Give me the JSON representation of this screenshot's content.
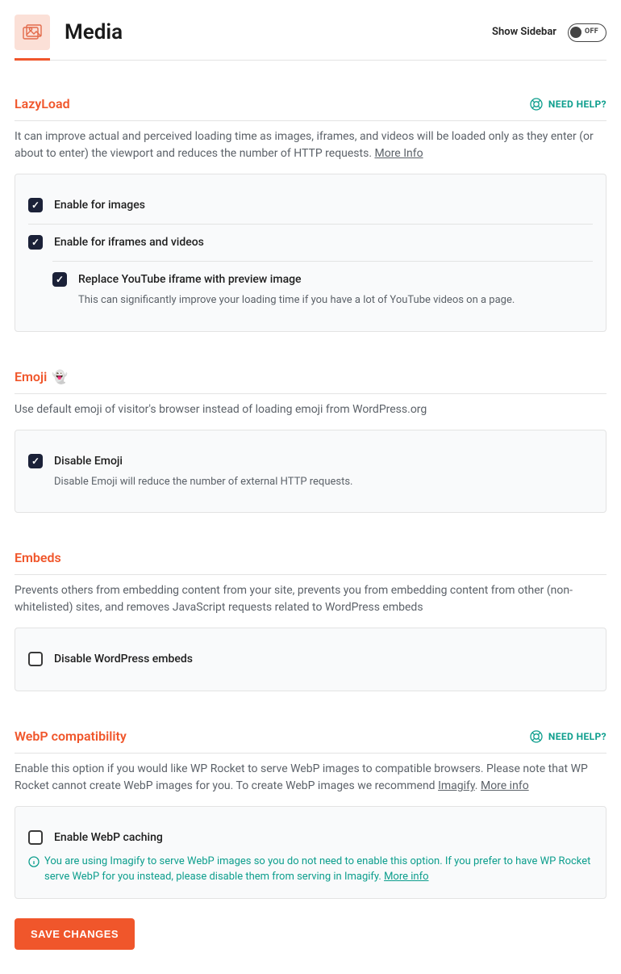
{
  "header": {
    "title": "Media",
    "sidebar_label": "Show Sidebar",
    "toggle_state": "OFF"
  },
  "help_label": "NEED HELP?",
  "sections": {
    "lazyload": {
      "title": "LazyLoad",
      "desc": "It can improve actual and perceived loading time as images, iframes, and videos will be loaded only as they enter (or about to enter) the viewport and reduces the number of HTTP requests. ",
      "more": "More Info",
      "opts": {
        "images": "Enable for images",
        "iframes": "Enable for iframes and videos",
        "youtube": "Replace YouTube iframe with preview image",
        "youtube_sub": "This can significantly improve your loading time if you have a lot of YouTube videos on a page."
      }
    },
    "emoji": {
      "title": "Emoji",
      "desc": "Use default emoji of visitor's browser instead of loading emoji from WordPress.org",
      "opts": {
        "disable": "Disable Emoji",
        "disable_sub": "Disable Emoji will reduce the number of external HTTP requests."
      }
    },
    "embeds": {
      "title": "Embeds",
      "desc": "Prevents others from embedding content from your site, prevents you from embedding content from other (non-whitelisted) sites, and removes JavaScript requests related to WordPress embeds",
      "opts": {
        "disable": "Disable WordPress embeds"
      }
    },
    "webp": {
      "title": "WebP compatibility",
      "desc_a": "Enable this option if you would like WP Rocket to serve WebP images to compatible browsers. Please note that WP Rocket cannot create WebP images for you. To create WebP images we recommend ",
      "imagify": "Imagify",
      "more": "More info",
      "opts": {
        "enable": "Enable WebP caching",
        "note": "You are using Imagify to serve WebP images so you do not need to enable this option. If you prefer to have WP Rocket serve WebP for you instead, please disable them from serving in Imagify. ",
        "note_more": "More info"
      }
    }
  },
  "save_label": "SAVE CHANGES"
}
